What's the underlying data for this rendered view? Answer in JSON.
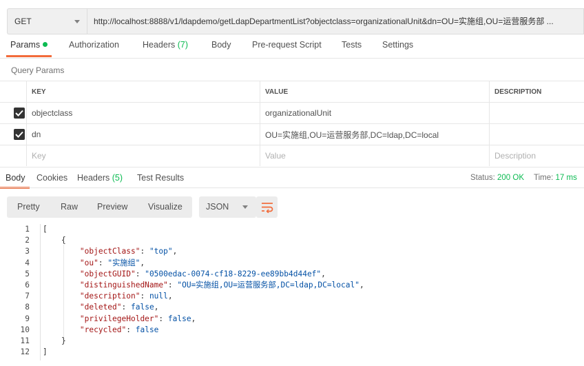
{
  "request": {
    "method": "GET",
    "url": "http://localhost:8888/v1/ldapdemo/getLdapDepartmentList?objectclass=organizationalUnit&dn=OU=实施组,OU=运营服务部 ..."
  },
  "request_tabs": [
    {
      "label": "Params",
      "count": ""
    },
    {
      "label": "Authorization",
      "count": ""
    },
    {
      "label": "Headers",
      "count": "(7)"
    },
    {
      "label": "Body",
      "count": ""
    },
    {
      "label": "Pre-request Script",
      "count": ""
    },
    {
      "label": "Tests",
      "count": ""
    },
    {
      "label": "Settings",
      "count": ""
    }
  ],
  "query_params": {
    "title": "Query Params",
    "headers": [
      "KEY",
      "VALUE",
      "DESCRIPTION"
    ],
    "rows": [
      {
        "key": "objectclass",
        "value": "organizationalUnit",
        "description": "",
        "checked": true
      },
      {
        "key": "dn",
        "value": "OU=实施组,OU=运营服务部,DC=ldap,DC=local",
        "description": "",
        "checked": true
      }
    ],
    "placeholders": {
      "key": "Key",
      "value": "Value",
      "description": "Description"
    }
  },
  "response_tabs": [
    {
      "label": "Body",
      "count": ""
    },
    {
      "label": "Cookies",
      "count": ""
    },
    {
      "label": "Headers",
      "count": "(5)"
    },
    {
      "label": "Test Results",
      "count": ""
    }
  ],
  "response_status": {
    "status_label": "Status:",
    "status_value": "200 OK",
    "time_label": "Time:",
    "time_value": "17 ms"
  },
  "view_modes": [
    "Pretty",
    "Raw",
    "Preview",
    "Visualize"
  ],
  "format": "JSON",
  "icons": {
    "wrap": "wrap-lines-icon",
    "check": "check-icon",
    "active_dot": "dot-icon"
  },
  "colors": {
    "accent": "#f26b3a",
    "success": "#0cbb52"
  },
  "code_lines": [
    [
      {
        "t": "p",
        "v": "["
      }
    ],
    [
      {
        "t": "p",
        "v": "    {"
      }
    ],
    [
      {
        "t": "p",
        "v": "        "
      },
      {
        "t": "k",
        "v": "\"objectClass\""
      },
      {
        "t": "p",
        "v": ": "
      },
      {
        "t": "s",
        "v": "\"top\""
      },
      {
        "t": "p",
        "v": ","
      }
    ],
    [
      {
        "t": "p",
        "v": "        "
      },
      {
        "t": "k",
        "v": "\"ou\""
      },
      {
        "t": "p",
        "v": ": "
      },
      {
        "t": "s",
        "v": "\"实施组\""
      },
      {
        "t": "p",
        "v": ","
      }
    ],
    [
      {
        "t": "p",
        "v": "        "
      },
      {
        "t": "k",
        "v": "\"objectGUID\""
      },
      {
        "t": "p",
        "v": ": "
      },
      {
        "t": "s",
        "v": "\"0500edac-0074-cf18-8229-ee89bb4d44ef\""
      },
      {
        "t": "p",
        "v": ","
      }
    ],
    [
      {
        "t": "p",
        "v": "        "
      },
      {
        "t": "k",
        "v": "\"distinguishedName\""
      },
      {
        "t": "p",
        "v": ": "
      },
      {
        "t": "s",
        "v": "\"OU=实施组,OU=运营服务部,DC=ldap,DC=local\""
      },
      {
        "t": "p",
        "v": ","
      }
    ],
    [
      {
        "t": "p",
        "v": "        "
      },
      {
        "t": "k",
        "v": "\"description\""
      },
      {
        "t": "p",
        "v": ": "
      },
      {
        "t": "n",
        "v": "null"
      },
      {
        "t": "p",
        "v": ","
      }
    ],
    [
      {
        "t": "p",
        "v": "        "
      },
      {
        "t": "k",
        "v": "\"deleted\""
      },
      {
        "t": "p",
        "v": ": "
      },
      {
        "t": "n",
        "v": "false"
      },
      {
        "t": "p",
        "v": ","
      }
    ],
    [
      {
        "t": "p",
        "v": "        "
      },
      {
        "t": "k",
        "v": "\"privilegeHolder\""
      },
      {
        "t": "p",
        "v": ": "
      },
      {
        "t": "n",
        "v": "false"
      },
      {
        "t": "p",
        "v": ","
      }
    ],
    [
      {
        "t": "p",
        "v": "        "
      },
      {
        "t": "k",
        "v": "\"recycled\""
      },
      {
        "t": "p",
        "v": ": "
      },
      {
        "t": "n",
        "v": "false"
      }
    ],
    [
      {
        "t": "p",
        "v": "    }"
      }
    ],
    [
      {
        "t": "p",
        "v": "]"
      }
    ]
  ]
}
